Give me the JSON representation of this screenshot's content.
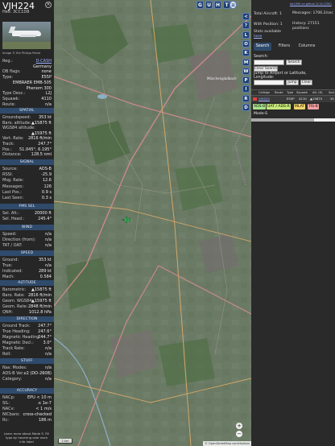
{
  "aircraft": {
    "callsign": "VJH224",
    "hex_label": "Hex:",
    "hex": "3CC1D8",
    "photo_credit": "Image © Bin Philipp Pielot"
  },
  "info_rows": [
    {
      "k": "Reg.:",
      "v": "D-CASH",
      "link": true
    },
    {
      "k": "",
      "v": "Germany"
    },
    {
      "k": "DB flags:",
      "v": "none"
    },
    {
      "k": "Type:",
      "v": "E55P"
    },
    {
      "k": "",
      "v": "EMBRAER EMB-505"
    },
    {
      "k": "",
      "v": "Phenom 300"
    },
    {
      "k": "Type Desc.:",
      "v": "L2J"
    },
    {
      "k": "Squawk:",
      "v": "4110"
    },
    {
      "k": "Route:",
      "v": "n/a"
    }
  ],
  "sections": {
    "spatial": "SPATIAL",
    "signal": "SIGNAL",
    "fms": "FMS SEL",
    "wind": "WIND",
    "speed": "SPEED",
    "altitude": "ALTITUDE",
    "direction": "DIRECTION",
    "stuff": "STUFF",
    "accuracy": "ACCURACY"
  },
  "spatial_rows": [
    {
      "k": "Groundspeed:",
      "v": "353 kt"
    },
    {
      "k": "Baro. altitude:",
      "v": "▲15875 ft"
    },
    {
      "k": "WGS84 altitude:",
      "v": ""
    },
    {
      "k": "",
      "v": "▲15975 ft"
    },
    {
      "k": "Vert. Rate:",
      "v": "2816 ft/min"
    },
    {
      "k": "Track:",
      "v": "247.7°"
    },
    {
      "k": "Pos.:",
      "v": "51.045°, 6.195°"
    },
    {
      "k": "Distance:",
      "v": "128.5 nmi"
    }
  ],
  "signal_rows": [
    {
      "k": "Source:",
      "v": "ADS-B"
    },
    {
      "k": "RSSI:",
      "v": "-25.9"
    },
    {
      "k": "Msg. Rate:",
      "v": "12.6"
    },
    {
      "k": "Messages:",
      "v": "126"
    },
    {
      "k": "Last Pos.:",
      "v": "0.9 s"
    },
    {
      "k": "Last Seen:",
      "v": "0.3 s"
    }
  ],
  "fms_rows": [
    {
      "k": "Sel. Alt.:",
      "v": "20000 ft"
    },
    {
      "k": "Sel. Head.:",
      "v": "245.4°"
    }
  ],
  "wind_rows": [
    {
      "k": "Speed:",
      "v": "n/a"
    },
    {
      "k": "Direction (from):",
      "v": "n/a"
    },
    {
      "k": "TAT / OAT:",
      "v": "n/a"
    }
  ],
  "speed_rows": [
    {
      "k": "Ground:",
      "v": "353 kt"
    },
    {
      "k": "True:",
      "v": "n/a"
    },
    {
      "k": "Indicated:",
      "v": "289 kt"
    },
    {
      "k": "Mach:",
      "v": "0.584"
    }
  ],
  "altitude_rows": [
    {
      "k": "Barometric:",
      "v": "▲15875 ft"
    },
    {
      "k": "Baro. Rate:",
      "v": "2816 ft/min"
    },
    {
      "k": "Geom. WGS84:",
      "v": "▲15975 ft"
    },
    {
      "k": "Geom. Rate:",
      "v": "2848 ft/min"
    },
    {
      "k": "QNH:",
      "v": "1012.8 hPa"
    }
  ],
  "direction_rows": [
    {
      "k": "Ground Track:",
      "v": "247.7°"
    },
    {
      "k": "True Heading:",
      "v": "247.6°"
    },
    {
      "k": "Magnetic Heading:",
      "v": "244.7°"
    },
    {
      "k": "Magnetic Decl.:",
      "v": "3.0°"
    },
    {
      "k": "Track Rate:",
      "v": "n/a"
    },
    {
      "k": "Roll:",
      "v": "n/a"
    }
  ],
  "stuff_rows": [
    {
      "k": "Nav. Modes:",
      "v": "n/a"
    },
    {
      "k": "ADS-B Ver.:",
      "v": "v2 (DO-260B)"
    },
    {
      "k": "Category:",
      "v": "n/a"
    }
  ],
  "accuracy_rows": [
    {
      "k": "NACp:",
      "v": "EPU < 10 m"
    },
    {
      "k": "SIL:",
      "v": "≤ 1e-7"
    },
    {
      "k": "NACv:",
      "v": "< 1 m/s"
    },
    {
      "k": "NICbaro:",
      "v": "cross-checked"
    },
    {
      "k": "Rc:",
      "v": "186 m"
    }
  ],
  "footer_note": "Learn more about Mode S. Fill type by hovering over each info label",
  "map": {
    "top_buttons": [
      "G",
      "U",
      "H",
      "T"
    ],
    "side_buttons": [
      "<",
      "?",
      "L",
      "O",
      "K",
      "M",
      "W",
      "P",
      "I",
      "R",
      "D"
    ],
    "zoom_in": "+",
    "zoom_out": "−",
    "scale": "2 km",
    "attribution": "© OpenStreetMap contributors",
    "place_label": "Mönchengladbach",
    "aircraft_color": "#2fc05a",
    "water_color": "#8bb0c8"
  },
  "right": {
    "version_link": "tar1090 on github (3.14.1250)",
    "total_aircraft": "Total Aircraft: 1",
    "with_position": "With Position: 1",
    "stats_available": "Stats available",
    "stats_link": "here",
    "messages": "Messages: 1706.2/sec",
    "history": "History: 27151 positions",
    "tabs": [
      "Search",
      "Filters",
      "Columns"
    ],
    "search_label": "Search:",
    "search_button": "Search",
    "clear_button": "Clear Search",
    "jump_label": "Jump to Airport or Latitude, Longitude:",
    "jump_button": "Jump",
    "clear2_button": "Clear",
    "table_headers": [
      "",
      "Callsign",
      "Route",
      "Type",
      "Squawk",
      "Alt. (ft)",
      "Spd."
    ],
    "table_row": [
      "",
      "VJH224",
      "",
      "E55P",
      "4110",
      "▲15875",
      "35"
    ],
    "source_chips": [
      {
        "label": "ADS-B",
        "color": "#a7e58a"
      },
      {
        "label": "UAT / ADS-R",
        "color": "#c7e87a"
      },
      {
        "label": "MLAT",
        "color": "#f0d36a"
      },
      {
        "label": "TIS-B",
        "color": "#f0a2a2"
      }
    ],
    "mode_s": "Mode-S"
  }
}
